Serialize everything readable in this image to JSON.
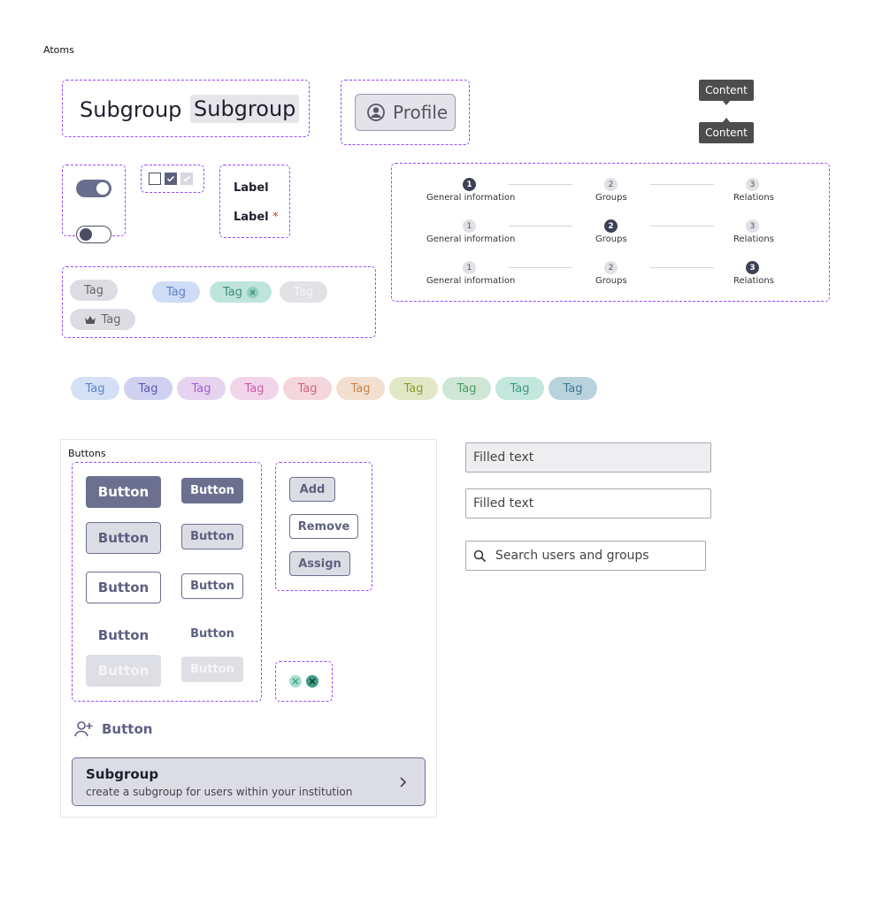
{
  "page": {
    "title": "Atoms"
  },
  "subgroup": {
    "plain": "Subgroup",
    "highlighted": "Subgroup"
  },
  "profile": {
    "label": "Profile",
    "icon": "user-circle-icon"
  },
  "tooltips": [
    {
      "text": "Content"
    },
    {
      "text": "Content"
    }
  ],
  "labels": {
    "label": "Label",
    "required_label": "Label",
    "required_mark": "*"
  },
  "stepper": {
    "steps": [
      "General  information",
      "Groups",
      "Relations"
    ],
    "numbers": [
      "1",
      "2",
      "3"
    ]
  },
  "tags_basic": {
    "default": "Tag",
    "blue": "Tag",
    "removable": "Tag",
    "disabled": "Tag",
    "crown": "Tag"
  },
  "tag_palette": [
    "Tag",
    "Tag",
    "Tag",
    "Tag",
    "Tag",
    "Tag",
    "Tag",
    "Tag",
    "Tag",
    "Tag"
  ],
  "buttons": {
    "section_title": "Buttons",
    "label": "Button",
    "add": "Add",
    "remove": "Remove",
    "assign": "Assign",
    "add_user": "Button"
  },
  "subgroup_card": {
    "title": "Subgroup",
    "description": "create a subgroup for users within your institution"
  },
  "fields": {
    "filled1": "Filled text",
    "filled2": "Filled text",
    "search_placeholder": "Search users and groups"
  },
  "colors": {
    "accent": "#6c7090",
    "dash_border": "#9747ff",
    "tooltip_bg": "#4d4d4d",
    "teal": "#3d9e85"
  }
}
